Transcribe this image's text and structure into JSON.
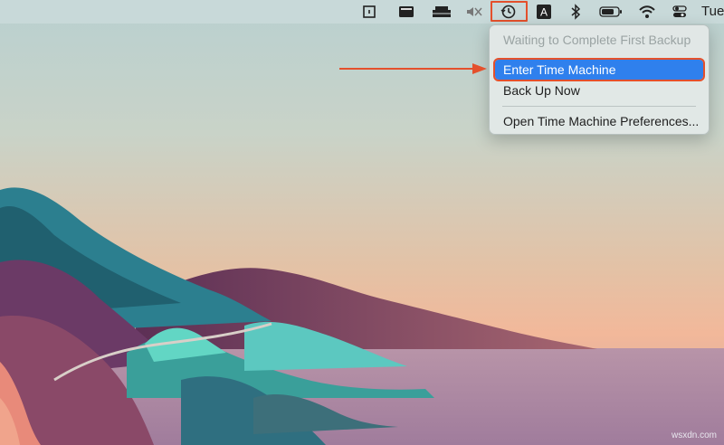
{
  "menubar": {
    "icons": [
      "note-icon",
      "display-icon",
      "keyboard-icon",
      "muted-speaker-icon",
      "time-machine-icon",
      "input-source-icon",
      "bluetooth-icon",
      "battery-icon",
      "wifi-icon",
      "control-center-icon"
    ],
    "input_source_letter": "A",
    "clock": "Tue"
  },
  "time_machine_menu": {
    "status": "Waiting to Complete First Backup",
    "items": [
      {
        "label": "Enter Time Machine",
        "selected": true
      },
      {
        "label": "Back Up Now",
        "selected": false
      },
      {
        "label": "Open Time Machine Preferences...",
        "selected": false
      }
    ]
  },
  "annotation": {
    "highlight_color": "#e4502c"
  },
  "accent_color": "#2f80ed",
  "watermark": "wsxdn.com"
}
